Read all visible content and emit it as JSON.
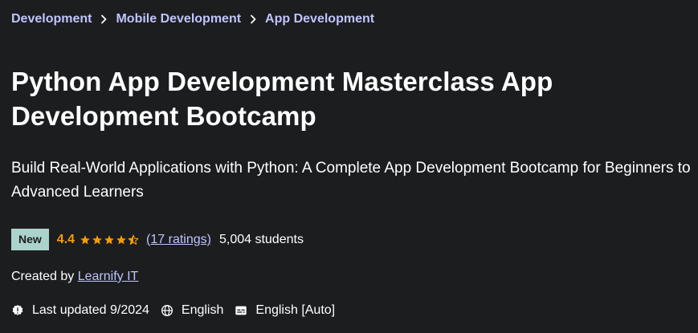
{
  "breadcrumb": {
    "items": [
      {
        "label": "Development"
      },
      {
        "label": "Mobile Development"
      },
      {
        "label": "App Development"
      }
    ],
    "separator_icon": "chevron-right-icon"
  },
  "course": {
    "title": "Python App Development Masterclass App Development Bootcamp",
    "subtitle": "Build Real-World Applications with Python: A Complete App Development Bootcamp for Beginners to Advanced Learners",
    "badge": "New",
    "rating": "4.4",
    "rating_value": 4.4,
    "rating_max": 5,
    "ratings_count": "(17 ratings)",
    "students": "5,004 students",
    "created_by_label": "Created by",
    "author": "Learnify IT",
    "last_updated": "Last updated 9/2024",
    "language": "English",
    "captions": "English [Auto]"
  },
  "colors": {
    "background": "#1c1d1f",
    "link": "#c0c4fc",
    "star": "#f69c08",
    "badge_bg": "#acd2cc",
    "text": "#ffffff"
  },
  "icons": {
    "last_updated": "alert-badge-icon",
    "language": "globe-icon",
    "captions": "closed-captions-icon",
    "star": "star-icon"
  }
}
